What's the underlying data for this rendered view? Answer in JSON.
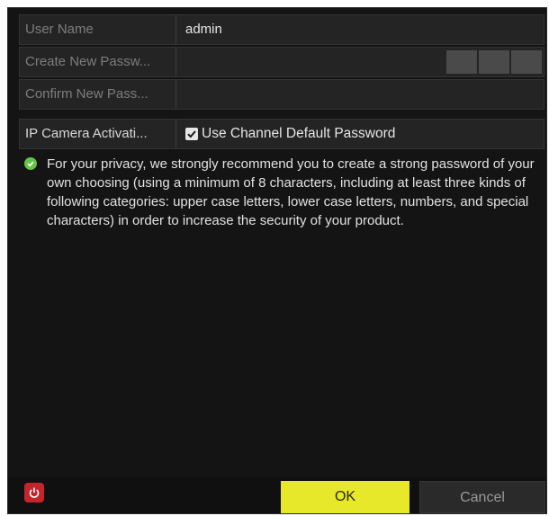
{
  "form": {
    "user_name_label": "User Name",
    "user_name_value": "admin",
    "create_password_label": "Create New Passw...",
    "create_password_value": "",
    "confirm_password_label": "Confirm New Pass...",
    "confirm_password_value": "",
    "ip_camera_label": "IP Camera Activati...",
    "use_default_password_label": "Use Channel Default Password",
    "use_default_password_checked": true
  },
  "notice": {
    "icon": "check-circle-icon",
    "text": "For your privacy, we strongly recommend you to create a strong password of your own choosing (using a minimum of 8 characters, including at least three kinds of following categories: upper case letters, lower case letters, numbers, and special characters) in order to increase the security of your product."
  },
  "footer": {
    "power_icon": "power-icon",
    "ok_label": "OK",
    "cancel_label": "Cancel"
  },
  "colors": {
    "ok_button": "#e8e82a",
    "power_button": "#c4242b",
    "notice_icon": "#66c24a",
    "dialog_background": "#141414"
  }
}
